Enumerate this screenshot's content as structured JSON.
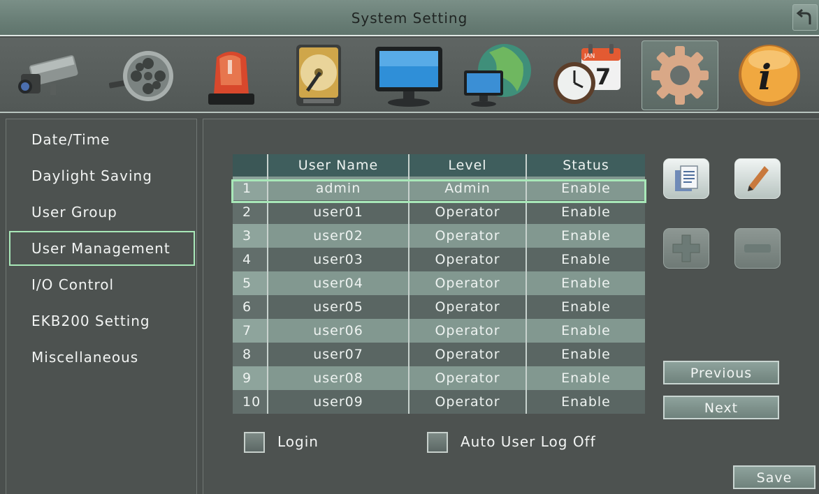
{
  "window": {
    "title": "System Setting"
  },
  "icon_bar": [
    {
      "name": "camera-icon",
      "active": false
    },
    {
      "name": "film-reel-icon",
      "active": false
    },
    {
      "name": "alarm-siren-icon",
      "active": false
    },
    {
      "name": "hard-drive-icon",
      "active": false
    },
    {
      "name": "monitor-icon",
      "active": false
    },
    {
      "name": "network-globe-icon",
      "active": false
    },
    {
      "name": "schedule-clock-calendar-icon",
      "active": false
    },
    {
      "name": "system-gear-icon",
      "active": true
    },
    {
      "name": "info-icon",
      "active": false
    }
  ],
  "calendar_icon": {
    "month": "JAN",
    "day": "7"
  },
  "info_icon": {
    "glyph": "i"
  },
  "menu": {
    "items": [
      "Date/Time",
      "Daylight Saving",
      "User Group",
      "User Management",
      "I/O Control",
      "EKB200 Setting",
      "Miscellaneous"
    ],
    "selected": "User Management"
  },
  "table": {
    "headers": [
      "",
      "User Name",
      "Level",
      "Status"
    ],
    "rows": [
      [
        "1",
        "admin",
        "Admin",
        "Enable"
      ],
      [
        "2",
        "user01",
        "Operator",
        "Enable"
      ],
      [
        "3",
        "user02",
        "Operator",
        "Enable"
      ],
      [
        "4",
        "user03",
        "Operator",
        "Enable"
      ],
      [
        "5",
        "user04",
        "Operator",
        "Enable"
      ],
      [
        "6",
        "user05",
        "Operator",
        "Enable"
      ],
      [
        "7",
        "user06",
        "Operator",
        "Enable"
      ],
      [
        "8",
        "user07",
        "Operator",
        "Enable"
      ],
      [
        "9",
        "user08",
        "Operator",
        "Enable"
      ],
      [
        "10",
        "user09",
        "Operator",
        "Enable"
      ]
    ],
    "selected_row": 1
  },
  "actions": {
    "copy": "copy-icon",
    "edit": "pencil-icon",
    "add": "plus-icon",
    "remove": "minus-icon"
  },
  "buttons": {
    "previous": "Previous",
    "next": "Next",
    "save": "Save"
  },
  "options": {
    "login": {
      "label": "Login",
      "checked": false
    },
    "auto_log_off": {
      "label": "Auto User Log Off",
      "checked": false
    }
  },
  "colors": {
    "selection_outline": "#a8e8b8",
    "header_bg": "#3f5e5d",
    "row_light": "#829890",
    "row_dark": "#5a6663"
  }
}
